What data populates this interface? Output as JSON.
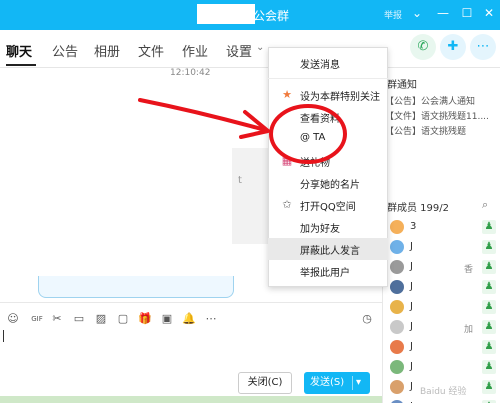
{
  "window": {
    "title_suffix": "公会群",
    "report": "举报",
    "controls": [
      "⌄",
      "—",
      "☐",
      "✕"
    ]
  },
  "tabs": [
    "聊天",
    "公告",
    "相册",
    "文件",
    "作业",
    "设置"
  ],
  "settings_chevron": "⌄",
  "chat": {
    "timestamp": "12:10:42",
    "ghost_letter": "t"
  },
  "dropdown": {
    "items": [
      {
        "label": "发送消息",
        "icon": ""
      },
      {
        "label": "设为本群特别关注",
        "icon": "special-follow-icon"
      },
      {
        "label": "查看资料",
        "icon": ""
      },
      {
        "label": "@ TA",
        "icon": ""
      },
      {
        "label": "送礼物",
        "icon": "gift-icon"
      },
      {
        "label": "分享她的名片",
        "icon": ""
      },
      {
        "label": "打开QQ空间",
        "icon": "star-icon"
      },
      {
        "label": "加为好友",
        "icon": ""
      },
      {
        "label": "屏蔽此人发言",
        "icon": ""
      },
      {
        "label": "举报此用户",
        "icon": ""
      }
    ]
  },
  "right_panel": {
    "notice_title": "群通知",
    "notices": [
      "【公告】公会满人通知",
      "【文件】语文挑残题11....",
      "【公告】语文挑残题"
    ],
    "members_title": "群成员 199/2",
    "members": [
      {
        "name": "3",
        "tag": ""
      },
      {
        "name": "J",
        "tag": ""
      },
      {
        "name": "J",
        "tag": "香"
      },
      {
        "name": "J",
        "tag": ""
      },
      {
        "name": "J",
        "tag": ""
      },
      {
        "name": "J",
        "tag": "加"
      },
      {
        "name": "J",
        "tag": ""
      },
      {
        "name": "J",
        "tag": ""
      },
      {
        "name": "J",
        "tag": ""
      },
      {
        "name": "J",
        "tag": ""
      }
    ]
  },
  "toolbar": {
    "tools": [
      "☺",
      "GIF",
      "✂",
      "▭",
      "▨",
      "▢",
      "🎁",
      "▣",
      "🔔",
      "⋯"
    ],
    "history": "◷"
  },
  "buttons": {
    "close": "关闭(C)",
    "send": "发送(S)",
    "send_arrow": "▾"
  },
  "watermark": "Baidu 经验",
  "colors": {
    "accent": "#12b7f5",
    "annotation": "#e8131b"
  }
}
